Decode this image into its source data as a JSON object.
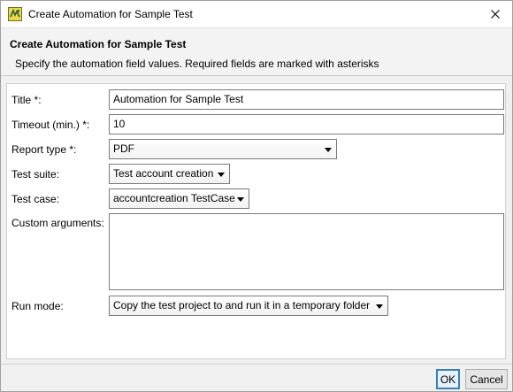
{
  "window": {
    "title": "Create Automation for Sample Test"
  },
  "header": {
    "title": "Create Automation for Sample Test",
    "description": "Specify the automation field values. Required fields are marked with asterisks"
  },
  "form": {
    "title_label": "Title *:",
    "title_value": "Automation for Sample Test",
    "timeout_label": "Timeout (min.) *:",
    "timeout_value": "10",
    "report_type_label": "Report type *:",
    "report_type_value": "PDF",
    "test_suite_label": "Test suite:",
    "test_suite_value": "Test account creation",
    "test_case_label": "Test case:",
    "test_case_value": "accountcreation TestCase",
    "custom_args_label": "Custom arguments:",
    "custom_args_value": "",
    "run_mode_label": "Run mode:",
    "run_mode_value": "Copy the test project to and run it in a temporary folder"
  },
  "buttons": {
    "ok": "OK",
    "cancel": "Cancel"
  },
  "icons": {
    "app": "app-logo-icon",
    "close": "close-icon",
    "dropdown": "chevron-down-icon"
  },
  "colors": {
    "app_icon_bg": "#e8d84a",
    "default_button_border": "#3c7fb1"
  }
}
